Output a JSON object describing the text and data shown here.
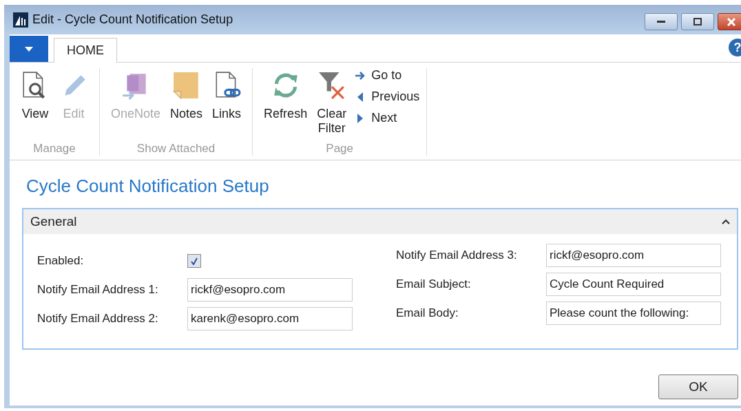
{
  "window": {
    "title": "Edit - Cycle Count Notification Setup"
  },
  "tabs": [
    {
      "label": "HOME",
      "selected": true
    }
  ],
  "help_button": "?",
  "ribbon_groups": [
    {
      "label": "Manage",
      "buttons": [
        {
          "kind": "large",
          "label": "View",
          "disabled": false
        },
        {
          "kind": "large",
          "label": "Edit",
          "disabled": true
        }
      ]
    },
    {
      "label": "Show Attached",
      "buttons": [
        {
          "kind": "large",
          "label": "OneNote",
          "disabled": true
        },
        {
          "kind": "large",
          "label": "Notes",
          "disabled": false
        },
        {
          "kind": "large",
          "label": "Links",
          "disabled": false
        }
      ]
    },
    {
      "label": "Page",
      "buttons": [
        {
          "kind": "large",
          "label": "Refresh",
          "disabled": false
        },
        {
          "kind": "large",
          "label": "Clear Filter",
          "disabled": false
        },
        {
          "kind": "small",
          "label": "Go to",
          "disabled": false
        },
        {
          "kind": "small",
          "label": "Previous",
          "disabled": false
        },
        {
          "kind": "small",
          "label": "Next",
          "disabled": false
        }
      ]
    }
  ],
  "page_title": "Cycle Count Notification Setup",
  "section": {
    "title": "General",
    "expanded": true,
    "columns": [
      [
        {
          "kind": "checkbox",
          "label": "Enabled:",
          "checked": true
        },
        {
          "kind": "text",
          "label": "Notify Email Address 1:",
          "value": "rickf@esopro.com"
        },
        {
          "kind": "text",
          "label": "Notify Email Address 2:",
          "value": "karenk@esopro.com"
        }
      ],
      [
        {
          "kind": "text",
          "label": "Notify Email Address 3:",
          "value": "rickf@esopro.com"
        },
        {
          "kind": "text",
          "label": "Email Subject:",
          "value": "Cycle Count Required"
        },
        {
          "kind": "text",
          "label": "Email Body:",
          "value": "Please count the following:"
        }
      ]
    ]
  },
  "buttons": [
    "OK"
  ]
}
